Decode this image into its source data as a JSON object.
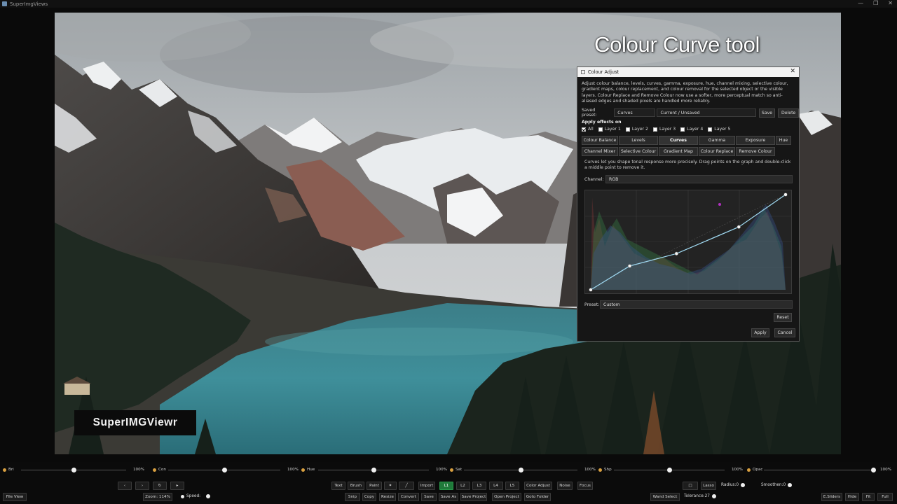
{
  "window": {
    "title": "SuperImgViews",
    "controls": [
      "—",
      "❐",
      "✕"
    ]
  },
  "overlay": {
    "title": "Colour Curve tool",
    "watermark": "SuperIMGViewr"
  },
  "dialog": {
    "title": "Colour Adjust",
    "close": "✕",
    "description": "Adjust colour balance, levels, curves, gamma, exposure, hue, channel mixing, selective colour, gradient maps, colour replacement, and colour removal for the selected object or the visible layers. Colour Replace and Remove Colour now use a softer, more perceptual match so anti-aliased edges and shaded pixels are handled more reliably.",
    "saved_preset_label": "Saved preset:",
    "saved_preset_value": "Curves",
    "current_value": "Current / Unsaved",
    "save": "Save",
    "delete": "Delete",
    "apply_effects_label": "Apply effects on",
    "layers": [
      {
        "label": "All",
        "checked": true
      },
      {
        "label": "Layer 1",
        "checked": false
      },
      {
        "label": "Layer 2",
        "checked": false
      },
      {
        "label": "Layer 3",
        "checked": false
      },
      {
        "label": "Layer 4",
        "checked": false
      },
      {
        "label": "Layer 5",
        "checked": false
      }
    ],
    "tabs_row1": [
      "Colour Balance",
      "Levels",
      "Curves",
      "Gamma",
      "Exposure",
      "Hue"
    ],
    "tabs_row2": [
      "Channel Mixer",
      "Selective Colour",
      "Gradient Map",
      "Colour Replace",
      "Remove Colour"
    ],
    "active_tab": "Curves",
    "curves_hint": "Curves let you shape tonal response more precisely. Drag points on the graph and double-click a middle point to remove it.",
    "channel_label": "Channel:",
    "channel_value": "RGB",
    "preset_label": "Preset:",
    "preset_value": "Custom",
    "reset": "Reset",
    "apply": "Apply",
    "cancel": "Cancel",
    "curve_points": [
      [
        0,
        0
      ],
      [
        0.2,
        0.25
      ],
      [
        0.44,
        0.38
      ],
      [
        0.76,
        0.66
      ],
      [
        1,
        1
      ]
    ]
  },
  "sliders": [
    {
      "icon": "sun-icon",
      "label": "Bri",
      "value": "100%",
      "level": 0.5
    },
    {
      "icon": "contrast-icon",
      "label": "Con",
      "value": "100%",
      "level": 0.5
    },
    {
      "icon": "hue-icon",
      "label": "Hue",
      "value": "100%",
      "level": 0.5
    },
    {
      "icon": "saturation-icon",
      "label": "Sat",
      "value": "100%",
      "level": 0.5
    },
    {
      "icon": "sharpen-icon",
      "label": "Shp",
      "value": "100%",
      "level": 0.5
    },
    {
      "icon": "opacity-icon",
      "label": "Opac",
      "value": "100%",
      "level": 1.0
    }
  ],
  "toolbar": {
    "nav": [
      "‹",
      "›",
      "↻",
      "▸"
    ],
    "tools": [
      "Text",
      "Brush",
      "Paint",
      "✦",
      "╱",
      "Import"
    ],
    "layers": [
      "L1",
      "L2",
      "L3",
      "L4",
      "L5"
    ],
    "active_layer": "L1",
    "actions": [
      "Color Adjust",
      "Noise",
      "Focus"
    ],
    "right": [
      "□",
      "Lasso"
    ],
    "radius": "Radius:0",
    "smoothen": "Smoothen:0",
    "file_view": "File View",
    "zoom": "Zoom: 114%",
    "speed": "Speed:",
    "row3": [
      "Snip",
      "Copy",
      "Resize",
      "Convert",
      "Save",
      "Save As",
      "Save Project",
      "Open Project",
      "Goto Folder"
    ],
    "wand": "Wand Select",
    "tolerance": "Tolerance:27",
    "right3": [
      "E.Sliders",
      "Hide",
      "Fit",
      "Full"
    ]
  }
}
